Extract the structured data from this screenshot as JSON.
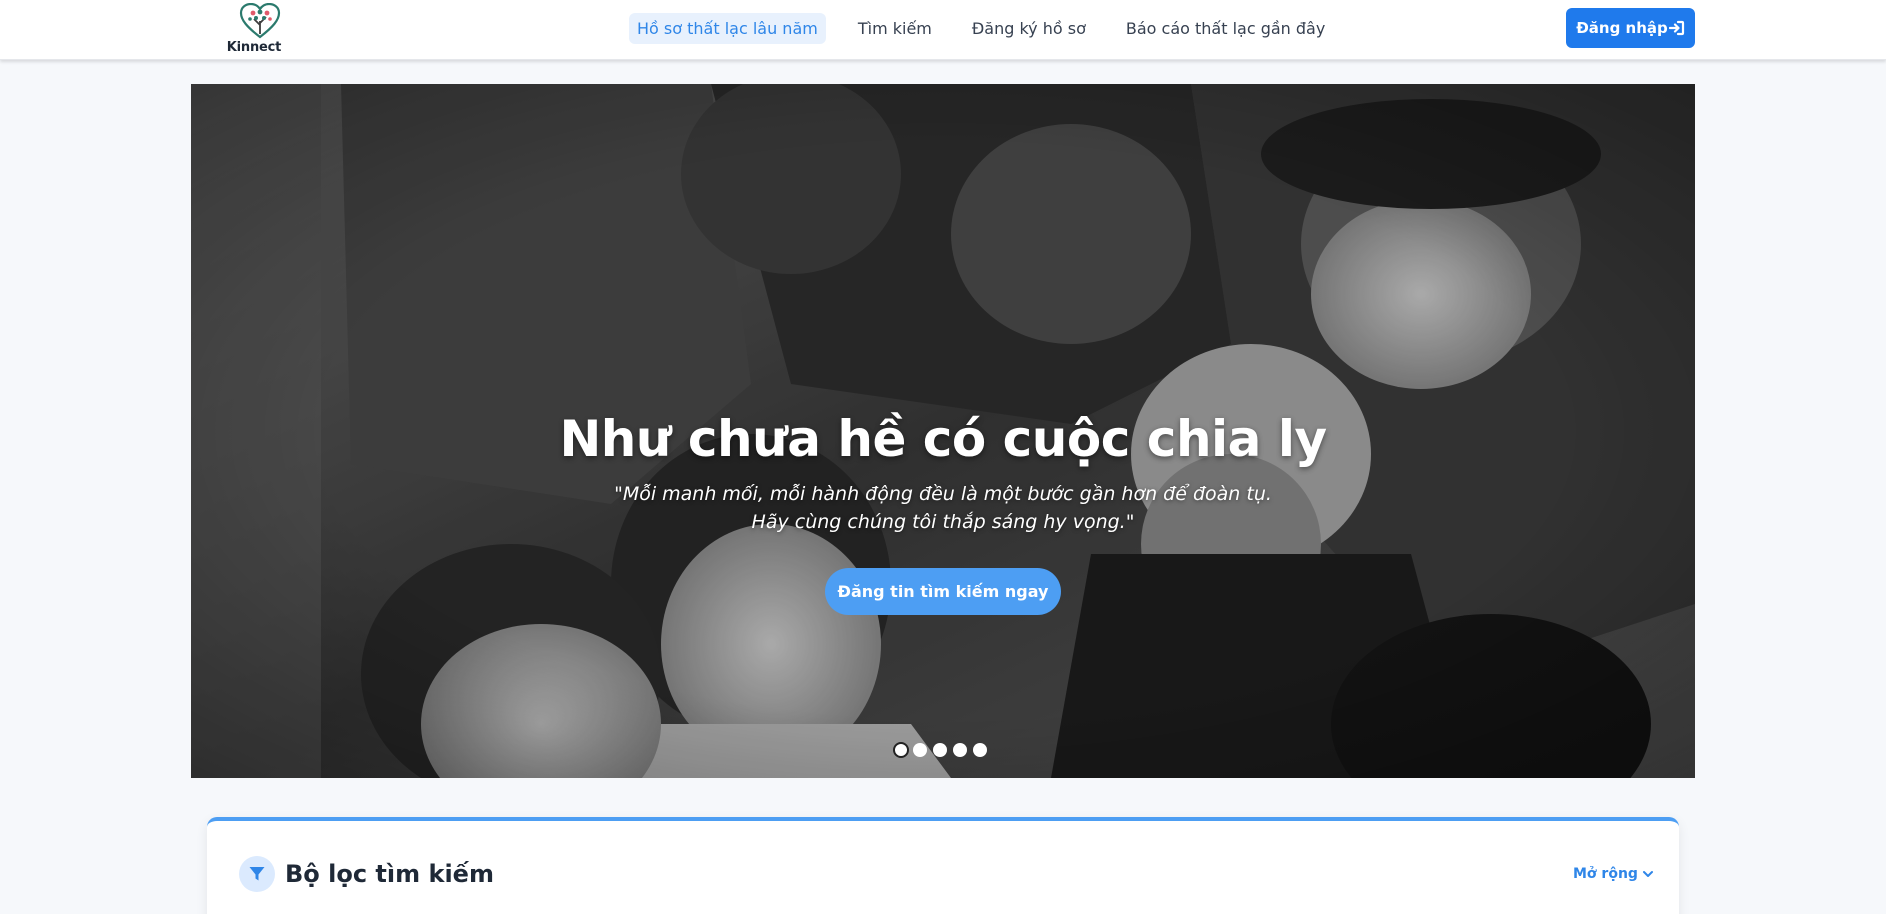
{
  "brand": {
    "name": "Kinnect"
  },
  "nav": {
    "items": [
      {
        "label": "Hồ sơ thất lạc lâu năm",
        "active": true
      },
      {
        "label": "Tìm kiếm",
        "active": false
      },
      {
        "label": "Đăng ký hồ sơ",
        "active": false
      },
      {
        "label": "Báo cáo thất lạc gần đây",
        "active": false
      }
    ],
    "login_label": "Đăng nhập"
  },
  "hero": {
    "title": "Như chưa hề có cuộc chia ly",
    "quote": "\"Mỗi manh mối, mỗi hành động đều là một bước gần hơn để đoàn tụ. Hãy cùng chúng tôi thắp sáng hy vọng.\"",
    "cta_label": "Đăng tin tìm kiếm ngay",
    "slides_total": 5,
    "active_slide": 1
  },
  "filter": {
    "title": "Bộ lọc tìm kiếm",
    "expand_label": "Mở rộng"
  },
  "colors": {
    "accent": "#1f7aec",
    "accent_light": "#4d9ef3",
    "active_nav_bg": "#e8f1fd"
  }
}
